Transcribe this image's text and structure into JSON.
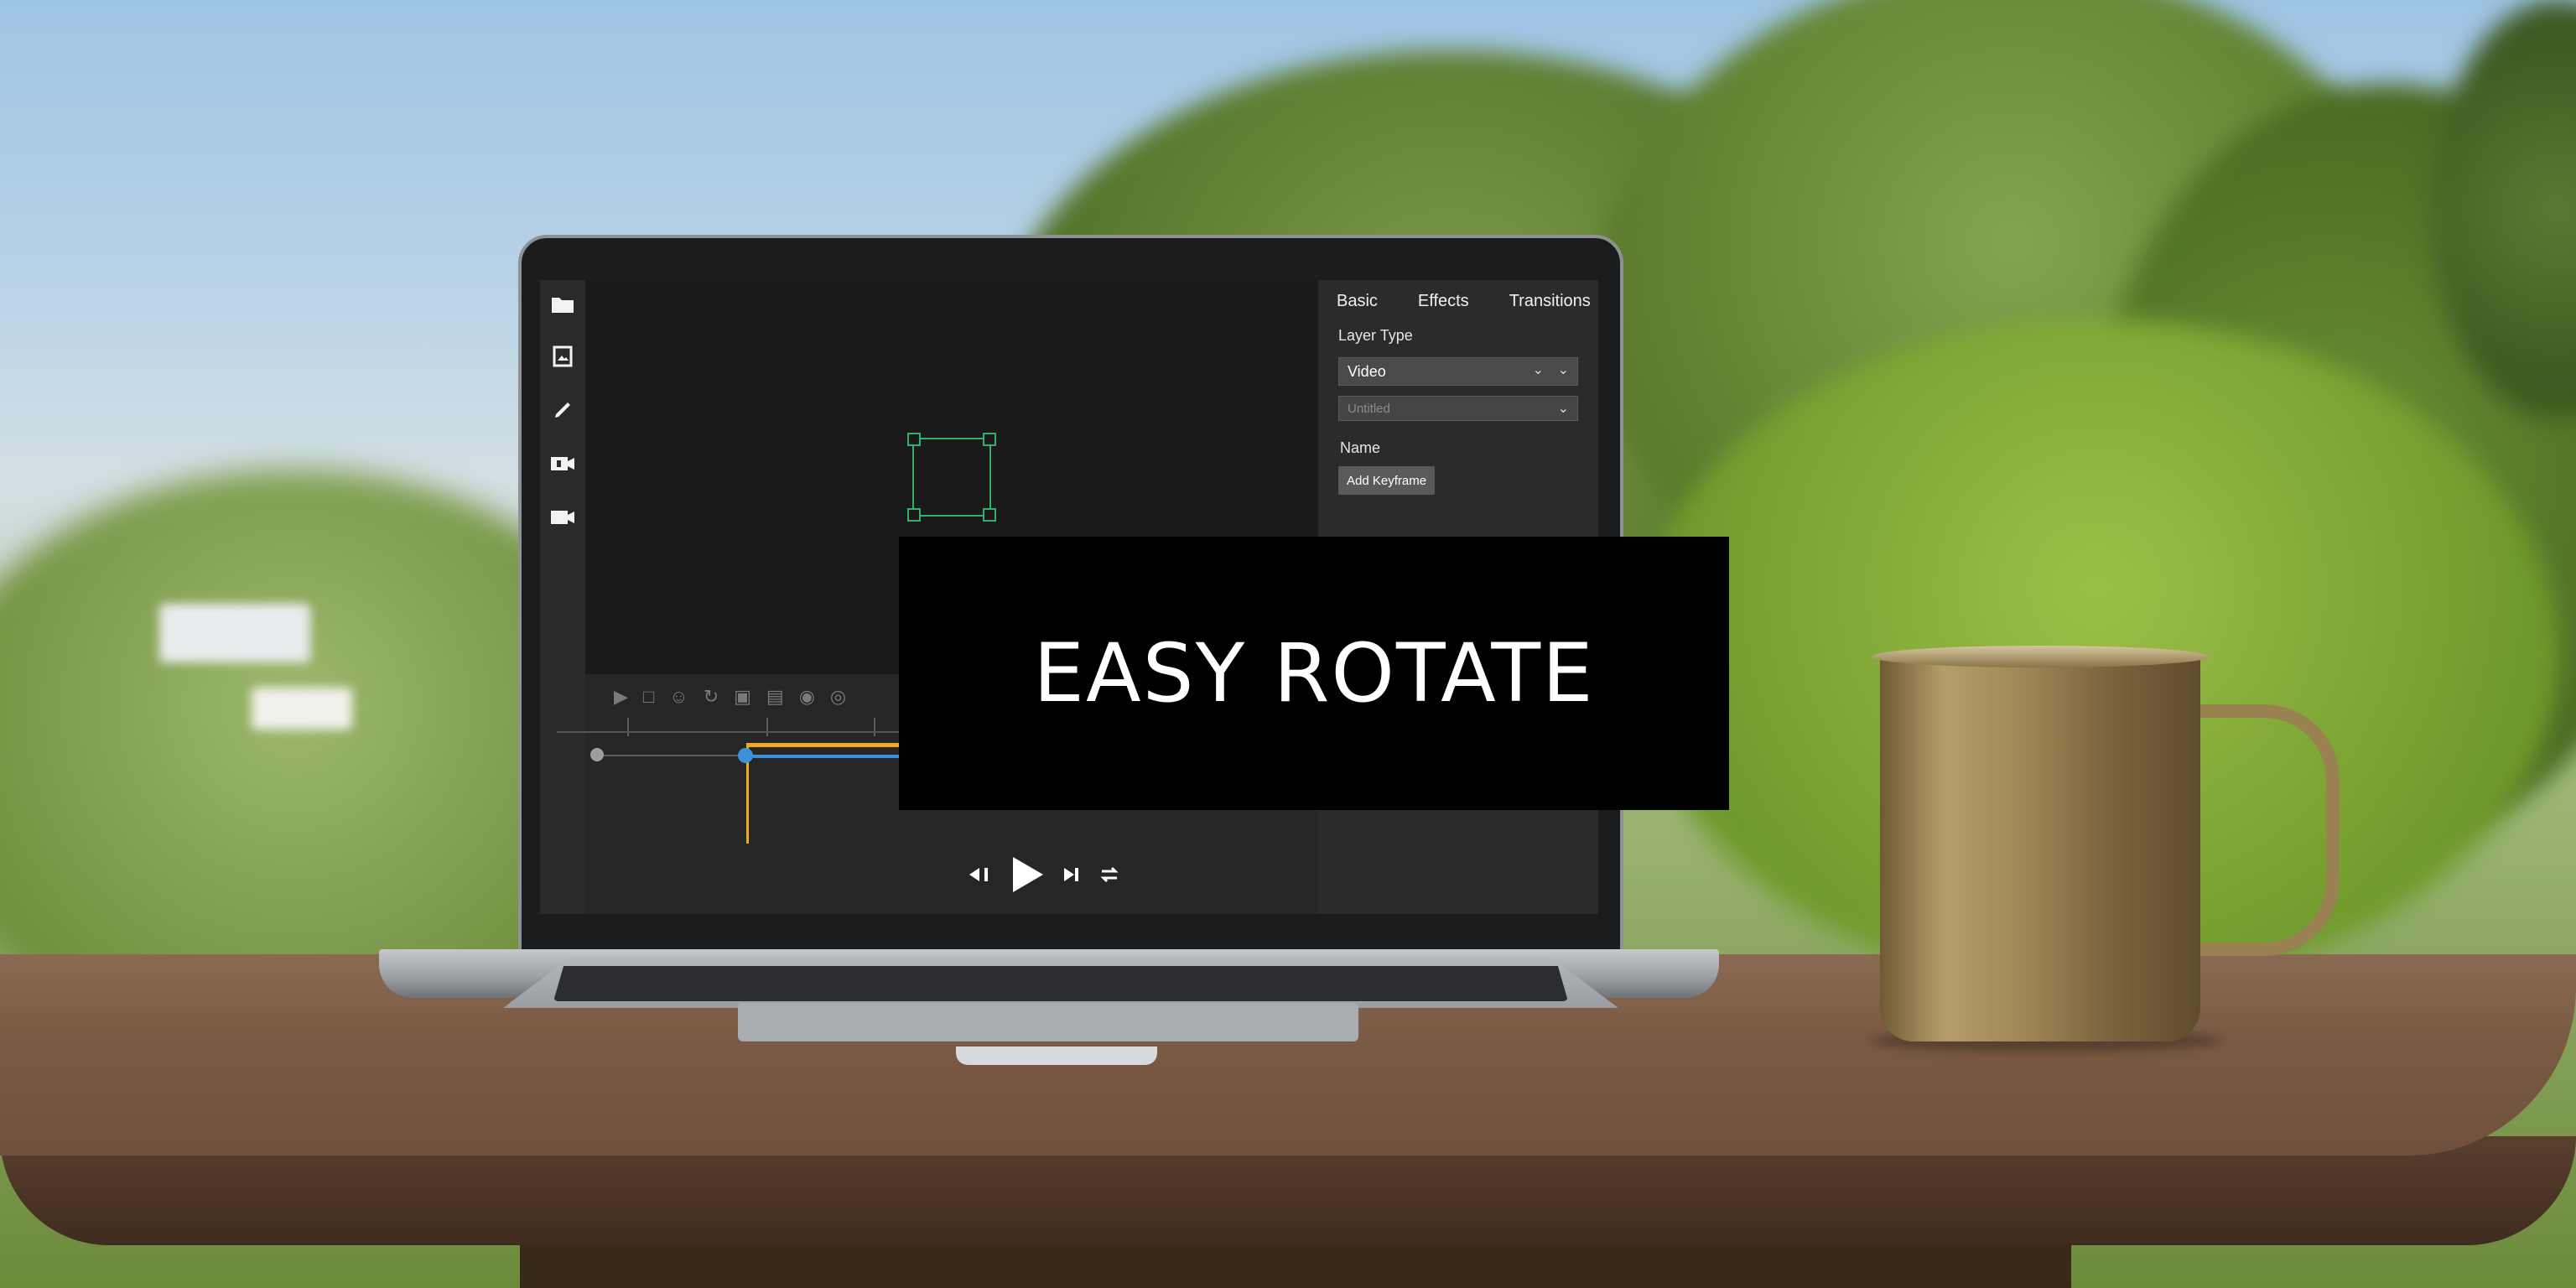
{
  "app": {
    "panel": {
      "tabs": [
        "Basic",
        "Effects",
        "Transitions"
      ],
      "layer_type_label": "Layer Type",
      "layer_type_value": "Video",
      "secondary_select_placeholder": "Untitled",
      "name_label": "Name",
      "add_keyframe_label": "Add Keyframe"
    },
    "toolbar_icons": [
      "folder-icon",
      "image-icon",
      "pen-icon",
      "clip-icon",
      "camera-icon"
    ],
    "timeline_icons": [
      "play-icon",
      "frame-icon",
      "person-icon",
      "rotate-icon",
      "layers-icon",
      "text-icon",
      "mask-icon",
      "effect-icon"
    ]
  },
  "overlay": {
    "headline": "EASY ROTATE"
  },
  "colors": {
    "selection_box": "#35b06a",
    "timeline_blue": "#3d91d8",
    "timeline_orange": "#f0a81d"
  }
}
